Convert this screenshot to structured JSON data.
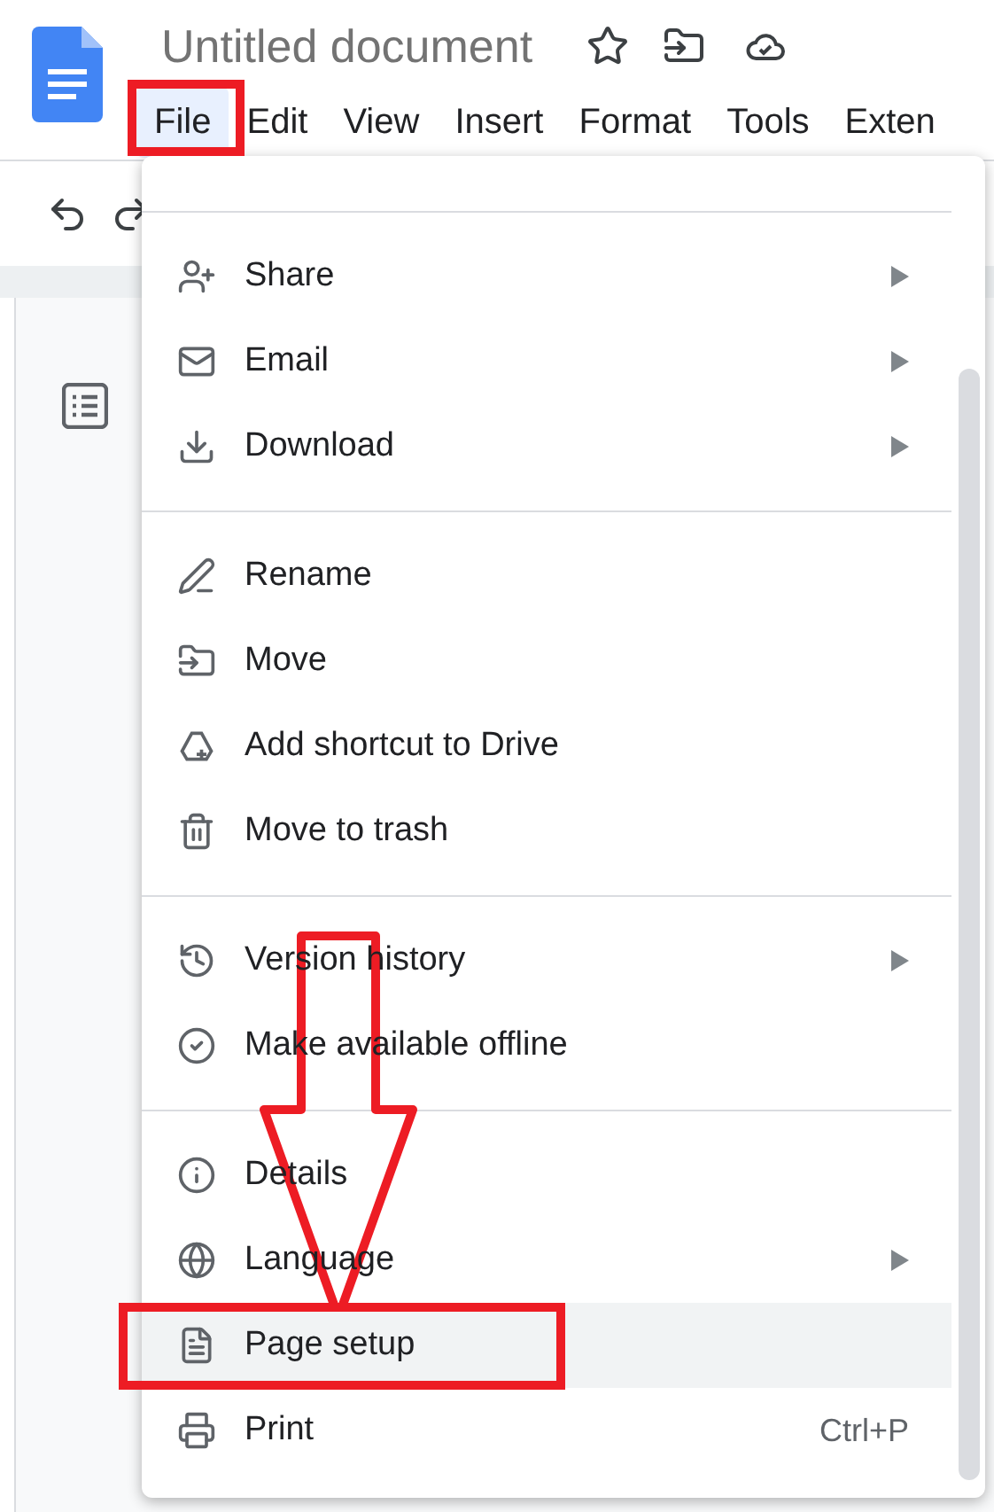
{
  "document": {
    "title": "Untitled document"
  },
  "menubar": [
    {
      "label": "File",
      "selected": true
    },
    {
      "label": "Edit",
      "selected": false
    },
    {
      "label": "View",
      "selected": false
    },
    {
      "label": "Insert",
      "selected": false
    },
    {
      "label": "Format",
      "selected": false
    },
    {
      "label": "Tools",
      "selected": false
    },
    {
      "label": "Exten",
      "selected": false
    }
  ],
  "file_menu": {
    "groups": [
      [
        {
          "label": "Share",
          "kind": "share",
          "submenu": true,
          "selected": false
        },
        {
          "label": "Email",
          "kind": "email",
          "submenu": true,
          "selected": false
        },
        {
          "label": "Download",
          "kind": "download",
          "submenu": true,
          "selected": false
        }
      ],
      [
        {
          "label": "Rename",
          "kind": "rename",
          "submenu": false,
          "selected": false
        },
        {
          "label": "Move",
          "kind": "move",
          "submenu": false,
          "selected": false
        },
        {
          "label": "Add shortcut to Drive",
          "kind": "shortcut",
          "submenu": false,
          "selected": false
        },
        {
          "label": "Move to trash",
          "kind": "trash",
          "submenu": false,
          "selected": false
        }
      ],
      [
        {
          "label": "Version history",
          "kind": "history",
          "submenu": true,
          "selected": false
        },
        {
          "label": "Make available offline",
          "kind": "offline",
          "submenu": false,
          "selected": false
        }
      ],
      [
        {
          "label": "Details",
          "kind": "info",
          "submenu": false,
          "selected": false
        },
        {
          "label": "Language",
          "kind": "globe",
          "submenu": true,
          "selected": false
        },
        {
          "label": "Page setup",
          "kind": "page",
          "submenu": false,
          "selected": true
        },
        {
          "label": "Print",
          "kind": "print",
          "submenu": false,
          "shortcut": "Ctrl+P",
          "selected": false
        }
      ]
    ]
  }
}
